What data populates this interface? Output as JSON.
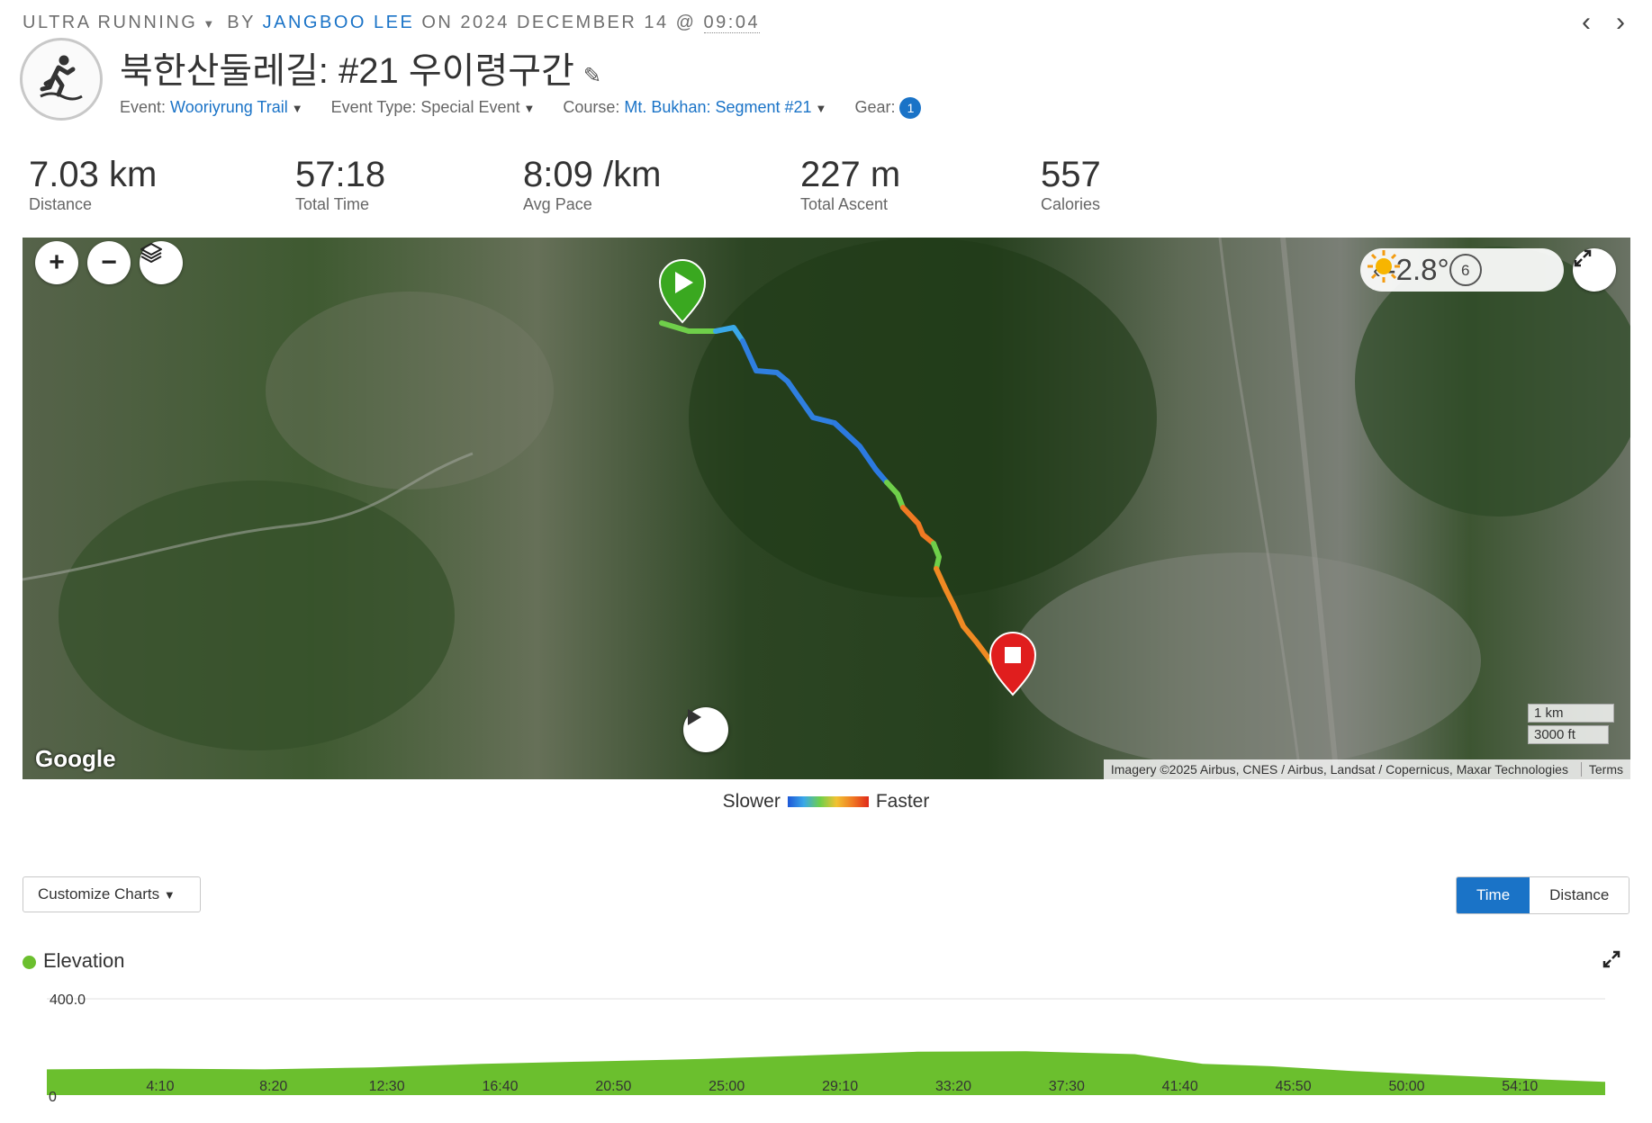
{
  "header": {
    "activity_type": "ULTRA RUNNING",
    "by_label": "BY",
    "author": "JANGBOO LEE",
    "on_label": "ON",
    "date": "2024 DECEMBER 14 @",
    "time": "09:04",
    "title": "북한산둘레길: #21 우이령구간",
    "prev_icon": "chevron-left-icon",
    "next_icon": "chevron-right-icon"
  },
  "fields": {
    "event_label": "Event:",
    "event_value": "Wooriyrung Trail",
    "event_type_label": "Event Type:",
    "event_type_value": "Special Event",
    "course_label": "Course:",
    "course_value": "Mt. Bukhan: Segment #21",
    "gear_label": "Gear:",
    "gear_count": "1"
  },
  "stats": [
    {
      "value": "7.03 km",
      "label": "Distance"
    },
    {
      "value": "57:18",
      "label": "Total Time"
    },
    {
      "value": "8:09 /km",
      "label": "Avg Pace"
    },
    {
      "value": "227 m",
      "label": "Total Ascent"
    },
    {
      "value": "557",
      "label": "Calories"
    }
  ],
  "map": {
    "weather_temp": "-2.8°",
    "weather_icon": "sun-icon",
    "weather_history": "6",
    "scale_km": "1 km",
    "scale_ft": "3000 ft",
    "attribution": "Imagery ©2025 Airbus, CNES / Airbus, Landsat / Copernicus, Maxar Technologies",
    "terms": "Terms",
    "logo": "Google",
    "start_marker_icon": "play-icon",
    "end_marker_icon": "stop-icon"
  },
  "legend": {
    "slower": "Slower",
    "faster": "Faster"
  },
  "controls": {
    "customize_label": "Customize Charts",
    "time_label": "Time",
    "distance_label": "Distance",
    "active_axis": "Time"
  },
  "colors": {
    "accent": "#1a73c7",
    "elevation_fill": "#6bbf2e",
    "start_marker": "#3aa820",
    "end_marker": "#e01e1e"
  },
  "chart_data": {
    "type": "area",
    "title": "Elevation",
    "x_tick_labels": [
      "4:10",
      "8:20",
      "12:30",
      "16:40",
      "20:50",
      "25:00",
      "29:10",
      "33:20",
      "37:30",
      "41:40",
      "45:50",
      "50:00",
      "54:10"
    ],
    "x_minutes": [
      0,
      4,
      8,
      12,
      16,
      20,
      24,
      28,
      32,
      36,
      40,
      42.5,
      45,
      48,
      52,
      55,
      57.3
    ],
    "y_values": [
      107,
      110,
      107,
      115,
      130,
      140,
      150,
      165,
      180,
      182,
      170,
      130,
      120,
      100,
      80,
      65,
      55
    ],
    "ylim": [
      0,
      400
    ],
    "y_tick_labels": [
      "0",
      "400.0"
    ],
    "series": [
      {
        "name": "Elevation",
        "color": "#6bbf2e"
      }
    ]
  }
}
